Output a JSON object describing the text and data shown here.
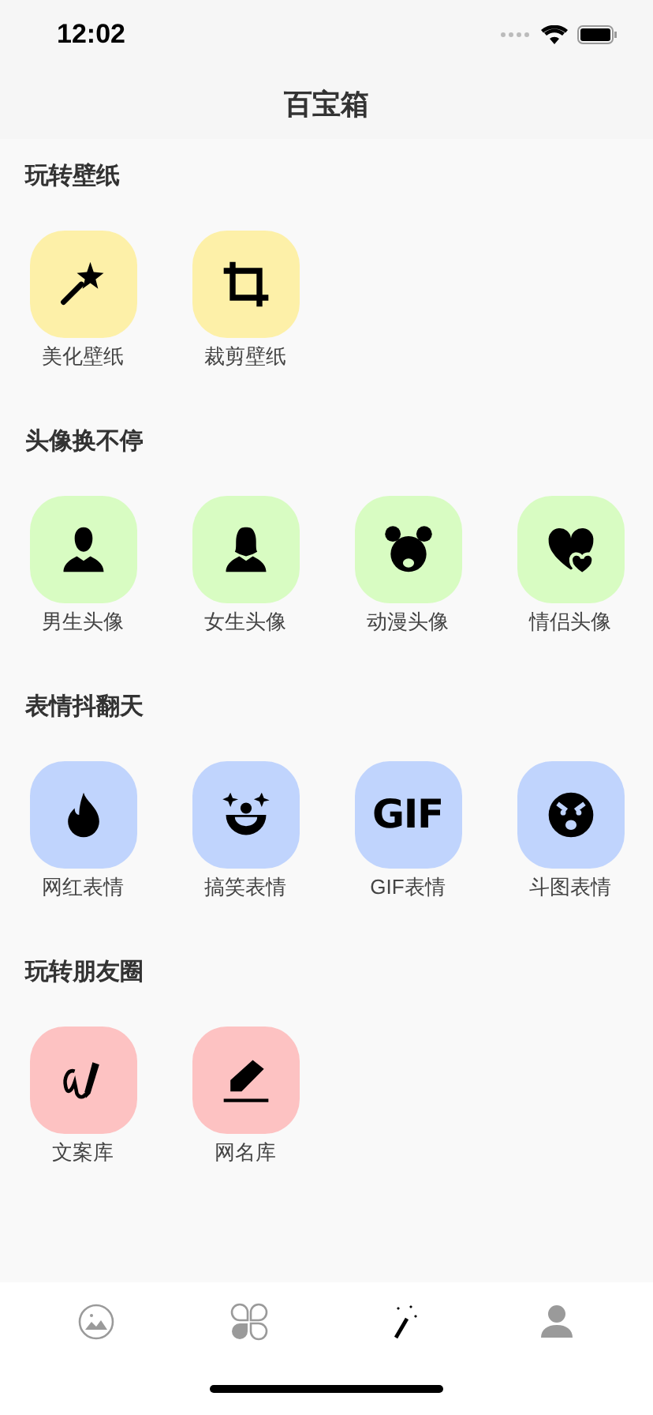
{
  "status_bar": {
    "time": "12:02"
  },
  "nav": {
    "title": "百宝箱"
  },
  "sections": [
    {
      "title": "玩转壁纸",
      "color": "#fdf0a8",
      "items": [
        {
          "label": "美化壁纸",
          "kind": "wand"
        },
        {
          "label": "裁剪壁纸",
          "kind": "crop"
        }
      ]
    },
    {
      "title": "头像换不停",
      "color": "#d8fcc2",
      "items": [
        {
          "label": "男生头像",
          "kind": "male"
        },
        {
          "label": "女生头像",
          "kind": "female"
        },
        {
          "label": "动漫头像",
          "kind": "bear"
        },
        {
          "label": "情侣头像",
          "kind": "hearts"
        }
      ]
    },
    {
      "title": "表情抖翻天",
      "color": "#c0d4fd",
      "items": [
        {
          "label": "网红表情",
          "kind": "fire"
        },
        {
          "label": "搞笑表情",
          "kind": "clown"
        },
        {
          "label": "GIF表情",
          "kind": "text",
          "glyph": "GIF"
        },
        {
          "label": "斗图表情",
          "kind": "angry"
        }
      ]
    },
    {
      "title": "玩转朋友圈",
      "color": "#fdc2c2",
      "items": [
        {
          "label": "文案库",
          "kind": "signature"
        },
        {
          "label": "网名库",
          "kind": "pencil"
        }
      ]
    }
  ],
  "tab_bar": [
    {
      "kind": "image",
      "selected": false
    },
    {
      "kind": "clover",
      "selected": false
    },
    {
      "kind": "wand",
      "selected": true
    },
    {
      "kind": "person",
      "selected": false
    }
  ]
}
